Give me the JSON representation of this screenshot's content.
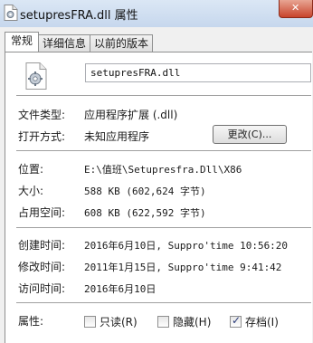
{
  "window": {
    "title": "setupresFRA.dll 属性",
    "close_icon": "close-icon"
  },
  "tabs": [
    {
      "label": "常规",
      "active": true
    },
    {
      "label": "详细信息",
      "active": false
    },
    {
      "label": "以前的版本",
      "active": false
    }
  ],
  "general": {
    "file_name": "setupresFRA.dll",
    "file_type_label": "文件类型:",
    "file_type_value": "应用程序扩展 (.dll)",
    "open_with_label": "打开方式:",
    "open_with_value": "未知应用程序",
    "change_button": "更改(C)...",
    "location_label": "位置:",
    "location_value": "E:\\值班\\Setupresfra.Dll\\X86",
    "size_label": "大小:",
    "size_value": "588 KB (602,624 字节)",
    "disk_size_label": "占用空间:",
    "disk_size_value": "608 KB (622,592 字节)",
    "created_label": "创建时间:",
    "created_value": "2016年6月10日, Suppro'time 10:56:20",
    "modified_label": "修改时间:",
    "modified_value": "2011年1月15日, Suppro'time 9:41:42",
    "accessed_label": "访问时间:",
    "accessed_value": "2016年6月10日",
    "attributes_label": "属性:",
    "attributes": [
      {
        "label": "只读(R)",
        "checked": false
      },
      {
        "label": "隐藏(H)",
        "checked": false
      },
      {
        "label": "存档(I)",
        "checked": true
      }
    ]
  }
}
